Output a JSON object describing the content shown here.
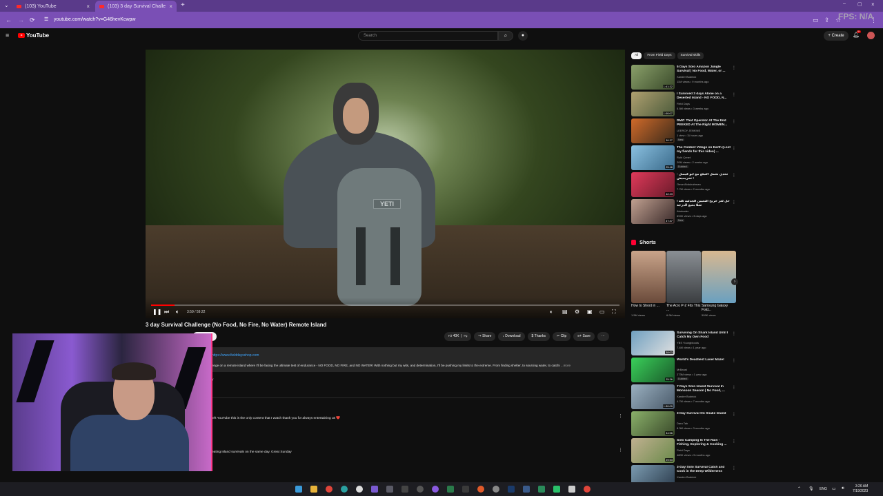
{
  "browser": {
    "tabs": [
      {
        "label": "(103) YouTube"
      },
      {
        "label": "(103) 3 day Survival Challe"
      }
    ],
    "url": "youtube.com/watch?v=G46hevKcwpw",
    "overlay": "FPS: N/A"
  },
  "youtube": {
    "logo": "YouTube",
    "search_placeholder": "Search",
    "create_label": "Create",
    "notif_count": "9+"
  },
  "player": {
    "timecode": "3:59 / 59:22",
    "progress_fraction": 0.05,
    "bag_brand": "YETI"
  },
  "video": {
    "title": "3 day Survival Challenge (No Food, No Fire, No Water) Remote Island",
    "like_count": "40K",
    "share": "Share",
    "download": "Download",
    "thanks": "Thanks",
    "clip": "Clip",
    "save": "Save",
    "desc_link": "https://www.fielddaysshop.com",
    "desc_text": "enge on a remote island where I'll be facing the ultimate test of endurance - NO FOOD, NO FIRE, and NO WATER! With nothing but my wits, and determination, I'll be pushing my limits to the extreme. From finding shelter, to sourcing water, to catchi",
    "desc_more": "...more",
    "desc_tail": "y"
  },
  "comments": [
    {
      "text": "left YouTube this is the only content that I watch thank you for always entertaining us ❤️"
    },
    {
      "text": "eating island survivals on the same day. Great Sunday"
    }
  ],
  "sidebar": {
    "chips": [
      {
        "label": "All"
      },
      {
        "label": "From Field Days"
      },
      {
        "label": "Survival skills"
      }
    ],
    "recommendations": [
      {
        "title": "5 Days Solo Amazon Jungle Survival | No Food, Water, or ...",
        "channel": "Xander Budnick",
        "meta": "11M views • 9 months ago",
        "duration": "1:41:32",
        "badge": ""
      },
      {
        "title": "I Survived 3 days Alone on a Deserted Island - NO FOOD, N...",
        "channel": "Field Days",
        "meta": "5.5M views • 3 weeks ago",
        "duration": "1:00:07",
        "badge": ""
      },
      {
        "title": "DMZ: That Operator At The End PEEKED At The Right MOMEN...",
        "channel": "LEEROY JENKINS",
        "meta": "1 view • 11 hours ago",
        "duration": "30:37",
        "badge": "New"
      },
      {
        "title": "The Coldest Village on Earth (Lost my fiends for this video) ...",
        "channel": "Ruhi Çenet",
        "meta": "20M views • 2 weeks ago",
        "duration": "25:46",
        "badge": "Dubbed"
      },
      {
        "title": "تحدي تحمل التبلغ مع ابو فيصل - تحريميش !",
        "channel": "Omar Abdulrahman",
        "meta": "7.7M views • 2 months ago",
        "duration": "42:43",
        "badge": ""
      },
      {
        "title": "حل لغز خريج التعيين الجدليه كله ! شلا بعبع الدرجة",
        "channel": "Abobader",
        "meta": "694K views • 3 days ago",
        "duration": "37:47",
        "badge": "New"
      },
      {
        "title": "Surviving On Shark Island Until I Catch My Own Food",
        "channel": "YBS Youngbloods",
        "meta": "7.4M views • 1 year ago",
        "duration": "38:03",
        "badge": ""
      },
      {
        "title": "World's Deadliest Laser Maze!",
        "channel": "MrBeast",
        "meta": "273M views • 1 year ago",
        "duration": "25:36",
        "badge": "Dubbed"
      },
      {
        "title": "7 Days Solo Island Survival In Monsoon Season | No Food, ...",
        "channel": "Xander Budnick",
        "meta": "4.7M views • 7 months ago",
        "duration": "1:30:09",
        "badge": ""
      },
      {
        "title": "3 Day Survival On Snake Island",
        "channel": "Dara Tah",
        "meta": "8.3M views • 3 months ago",
        "duration": "34:56",
        "badge": ""
      },
      {
        "title": "Solo Camping In The Rain - Fishing, Exploring & Cooking ...",
        "channel": "Field Days",
        "meta": "480K views • 9 months ago",
        "duration": "29:53",
        "badge": ""
      },
      {
        "title": "3-Day Solo Survival Catch and Cook in the Deep Wilderness",
        "channel": "Xander Budnick",
        "meta": "",
        "duration": "",
        "badge": ""
      }
    ],
    "shorts_heading": "Shorts",
    "shorts": [
      {
        "title": "How to Shoot in ...",
        "views": "1.5M views"
      },
      {
        "title": "The Acro P-2 Fits This ...",
        "views": "6.9M views"
      },
      {
        "title": "Samsung Galaxy Fold...",
        "views": "599K views"
      }
    ]
  },
  "taskbar": {
    "lang": "ENG",
    "time": "3:26 AM",
    "date": "7/19/2023"
  },
  "colors": {
    "accent": "#ff0000",
    "browser_chrome": "#7a4fb5",
    "tabbar": "#5a3a8a",
    "link": "#3ea6ff"
  }
}
